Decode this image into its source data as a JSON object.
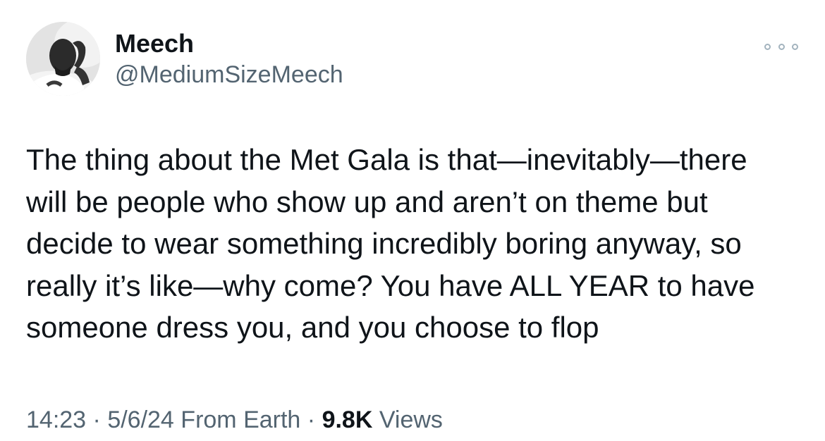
{
  "author": {
    "display_name": "Meech",
    "handle": "@MediumSizeMeech"
  },
  "tweet": {
    "text": "The thing about the Met Gala is that—inevitably—there\nwill be people who show up and aren’t on theme but\ndecide to wear something incredibly boring anyway, so\nreally it’s like—why come? You have ALL YEAR to have\nsomeone dress you, and you choose to flop"
  },
  "meta": {
    "time": "14:23",
    "separator": " · ",
    "date": "5/6/24",
    "source": "From Earth",
    "views_count": "9.8K",
    "views_label": "Views"
  },
  "icons": {
    "more": "more-options-icon"
  },
  "colors": {
    "primary_text": "#0f1419",
    "secondary_text": "#536471",
    "background": "#ffffff"
  }
}
